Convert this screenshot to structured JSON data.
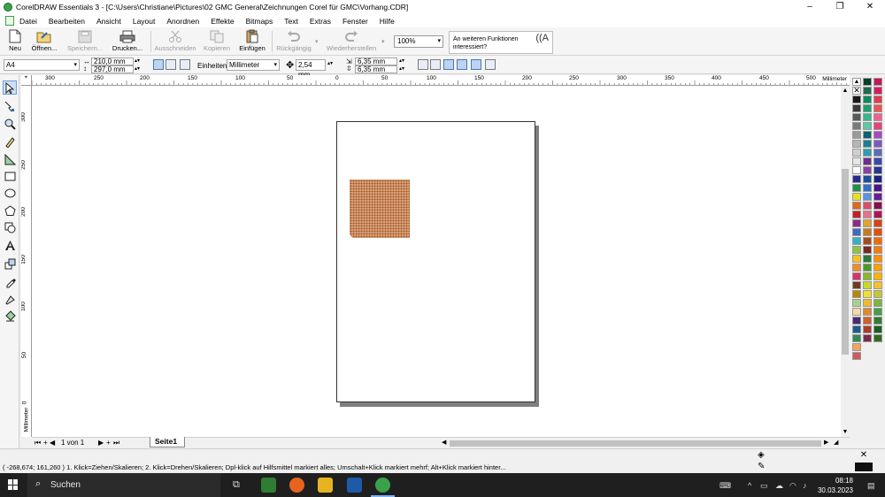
{
  "window": {
    "title": "CorelDRAW Essentials 3 - [C:\\Users\\Christiane\\Pictures\\02 GMC General\\Zeichnungen Corel für GMC\\Vorhang.CDR]",
    "controls": [
      "–",
      "❐",
      "✕"
    ]
  },
  "menu": [
    "Datei",
    "Bearbeiten",
    "Ansicht",
    "Layout",
    "Anordnen",
    "Effekte",
    "Bitmaps",
    "Text",
    "Extras",
    "Fenster",
    "Hilfe"
  ],
  "toolbar": {
    "new": "Neu",
    "open": "Öffnen...",
    "save": "Speichern...",
    "print": "Drucken...",
    "cut": "Ausschneiden",
    "copy": "Kopieren",
    "paste": "Einfügen",
    "undo": "Rückgängig",
    "redo": "Wiederherstellen",
    "zoom": "100%",
    "hint": "An weiteren Funktionen interessiert?"
  },
  "propbar": {
    "page_size": "A4",
    "width": "210,0 mm",
    "height": "297,0 mm",
    "units_label": "Einheiten:",
    "units_value": "Millimeter",
    "nudge": "2,54 mm",
    "dup_x": "6,35 mm",
    "dup_y": "6,35 mm"
  },
  "ruler": {
    "unit": "Millimeter",
    "h_ticks": [
      "300",
      "250",
      "200",
      "150",
      "100",
      "50",
      "0",
      "50",
      "100",
      "150",
      "200",
      "250",
      "300",
      "350",
      "400",
      "450",
      "500"
    ],
    "v_ticks": [
      "300",
      "250",
      "200",
      "150",
      "100",
      "50",
      "0"
    ],
    "v_unit": "Millimeter"
  },
  "pagebar": {
    "page_count": "1 von 1",
    "page_tab": "Seite1"
  },
  "status": {
    "text": "( -268,674; 161,260 )   1. Klick=Ziehen/Skalieren; 2. Klick=Drehen/Skalieren; Dpl-klick auf Hilfsmittel markiert alles; Umschalt+Klick markiert mehrf; Alt+Klick markiert hinter..."
  },
  "taskbar": {
    "search": "Suchen",
    "time": "08:18",
    "date": "30.03.2023"
  },
  "palette_colors": [
    "#1a1a1a",
    "#3a3a3a",
    "#595959",
    "#7a7a7a",
    "#9a9a9a",
    "#b5b5b5",
    "#cfcfcf",
    "#e6e6e6",
    "#ffffff",
    "#2b2b8c",
    "#1f8f4a",
    "#e8e01e",
    "#e06a1a",
    "#c21f2f",
    "#8c2a8c",
    "#3a6bc4",
    "#36b0c9",
    "#8cc63f",
    "#f3c31f",
    "#f28c28",
    "#d6336c",
    "#6e3b1e",
    "#b8860b",
    "#a9d18e",
    "#f9d7a0",
    "#4a2a6e",
    "#1e5a8c",
    "#2e8b57",
    "#f4a460",
    "#cd5c5c"
  ],
  "palette_colors_2": [
    "#0b3d2e",
    "#1f6b4a",
    "#0f8a5f",
    "#1aa36e",
    "#35b88a",
    "#5cc9a3",
    "#0d5f73",
    "#1b7f94",
    "#2d9db3",
    "#6f2d8c",
    "#8c3fa8",
    "#1f4e9c",
    "#2e6fd1",
    "#5a93e0",
    "#d94f6b",
    "#e8708a",
    "#e0a32d",
    "#c97b1a",
    "#a34d1a",
    "#7a2a1a",
    "#2a7a3a",
    "#4a9a2a",
    "#8ab82a",
    "#c8d82a",
    "#f0e02a",
    "#f0b82a",
    "#e08a2a",
    "#d0602a",
    "#b03a2a",
    "#802a4a"
  ],
  "palette_colors_3": [
    "#c2185b",
    "#d81b60",
    "#e53950",
    "#ef5350",
    "#f06292",
    "#ec407a",
    "#ab47bc",
    "#7e57c2",
    "#5c6bc0",
    "#3949ab",
    "#283593",
    "#1a237e",
    "#4a148c",
    "#6a1b9a",
    "#880e4f",
    "#ad1457",
    "#d84315",
    "#e65100",
    "#ef6c00",
    "#f57c00",
    "#ff8f00",
    "#ffa000",
    "#ffb300",
    "#fbc02d",
    "#c0ca33",
    "#7cb342",
    "#43a047",
    "#2e7d32",
    "#1b5e20",
    "#33691e"
  ]
}
